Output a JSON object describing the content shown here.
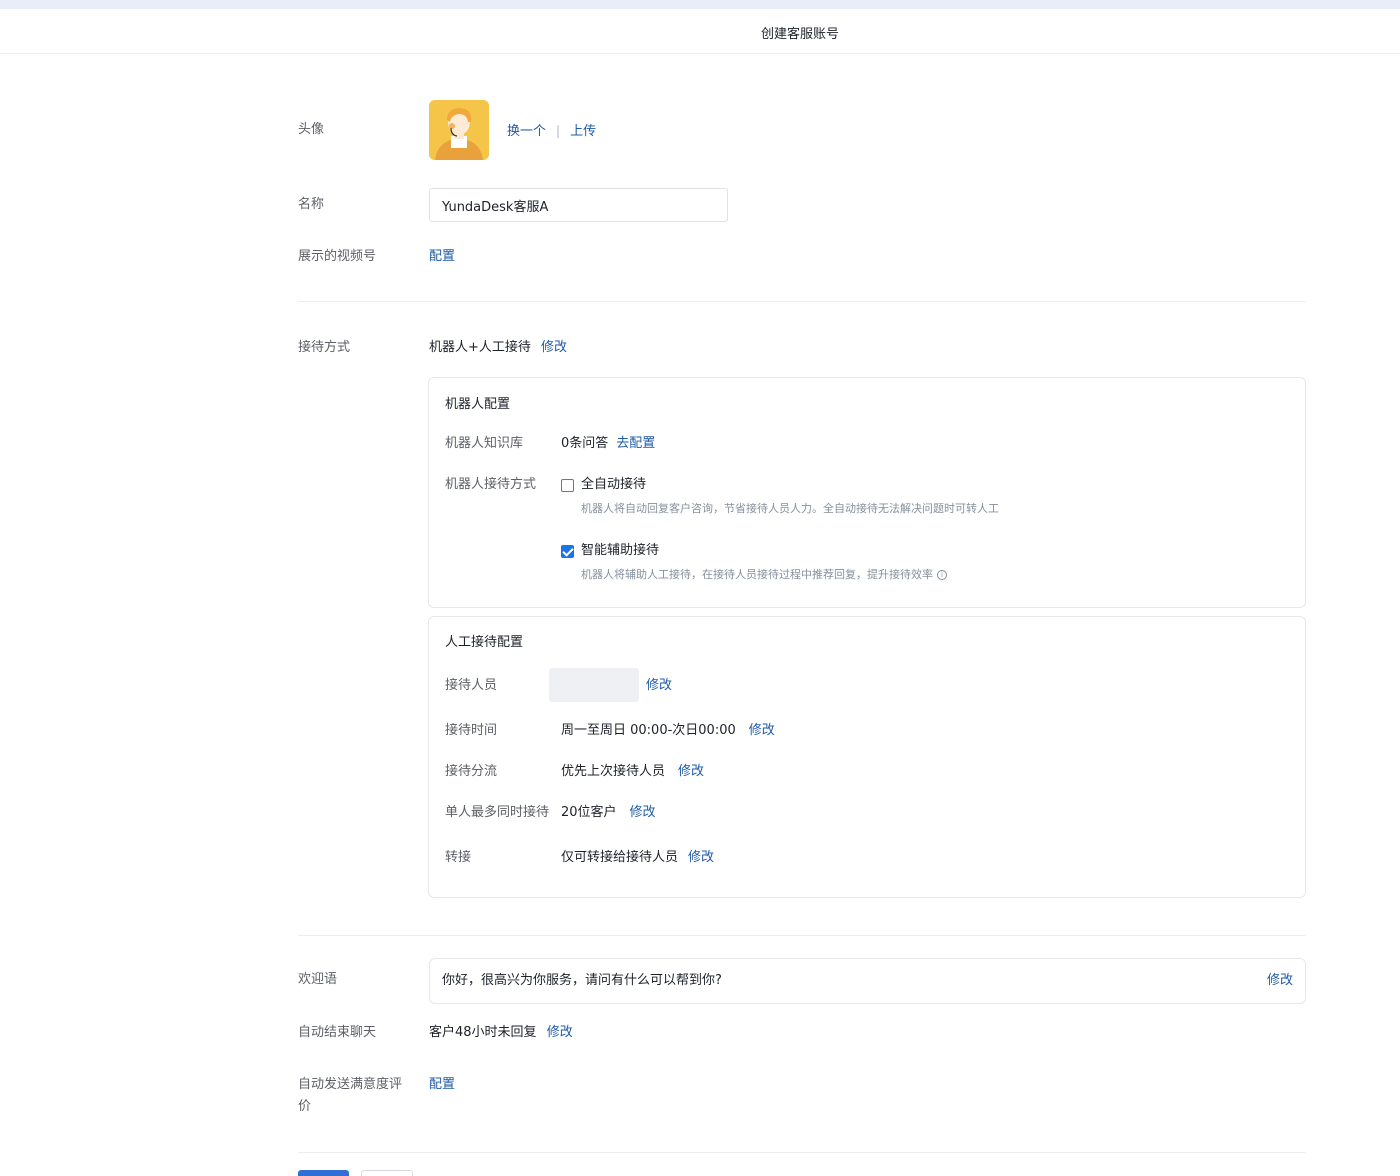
{
  "header": {
    "title": "创建客服账号"
  },
  "avatar": {
    "label": "头像",
    "change_label": "换一个",
    "separator": "|",
    "upload_label": "上传"
  },
  "name": {
    "label": "名称",
    "value": "YundaDesk客服A"
  },
  "video": {
    "label": "展示的视频号",
    "config_label": "配置"
  },
  "reception_mode": {
    "label": "接待方式",
    "value": "机器人+人工接待",
    "edit_label": "修改"
  },
  "robot_config": {
    "title": "机器人配置",
    "kb_label": "机器人知识库",
    "kb_value": "0条问答",
    "kb_link": "去配置",
    "mode_label": "机器人接待方式",
    "options": [
      {
        "label": "全自动接待",
        "checked": false,
        "desc": "机器人将自动回复客户咨询，节省接待人员人力。全自动接待无法解决问题时可转人工"
      },
      {
        "label": "智能辅助接待",
        "checked": true,
        "desc": "机器人将辅助人工接待，在接待人员接待过程中推荐回复，提升接待效率"
      }
    ]
  },
  "human_config": {
    "title": "人工接待配置",
    "staff_label": "接待人员",
    "staff_edit": "修改",
    "time_label": "接待时间",
    "time_value": "周一至周日 00:00-次日00:00",
    "time_edit": "修改",
    "dispatch_label": "接待分流",
    "dispatch_value": "优先上次接待人员",
    "dispatch_edit": "修改",
    "max_label": "单人最多同时接待",
    "max_value": "20位客户",
    "max_edit": "修改",
    "transfer_label": "转接",
    "transfer_value": "仅可转接给接待人员",
    "transfer_edit": "修改"
  },
  "welcome": {
    "label": "欢迎语",
    "value": "你好，很高兴为你服务，请问有什么可以帮到你?",
    "edit_label": "修改"
  },
  "auto_end": {
    "label": "自动结束聊天",
    "value": "客户48小时未回复",
    "edit_label": "修改"
  },
  "satisfaction": {
    "label_line1": "自动发送满意度评",
    "label_line2": "价",
    "config_label": "配置"
  },
  "colors": {
    "link": "#1f5aa8",
    "primary": "#2f6fd6",
    "checkbox": "#1a73e8"
  }
}
